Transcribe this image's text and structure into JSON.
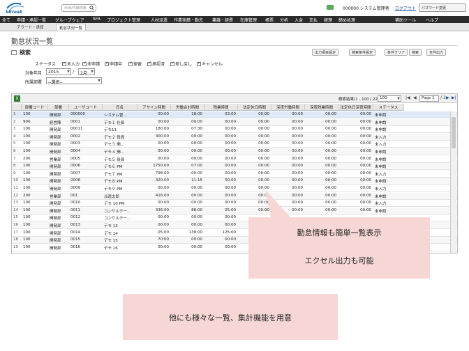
{
  "header": {
    "logo_text": "bBreak",
    "search_placeholder": "外線/内線検索",
    "user": "000000 システム管理者",
    "logout": "ログアウト",
    "password_button": "パスワード変更"
  },
  "menu": {
    "items": [
      "全て",
      "申請・承認一覧",
      "グループウェア",
      "SFA",
      "プロジェクト管理",
      "人材派遣",
      "作業実績・勤怠",
      "稟議・経費",
      "在庫管理",
      "帳票",
      "分析",
      "入金",
      "支払",
      "経理",
      "締め処理"
    ],
    "right": [
      "補助ツール",
      "ヘルプ"
    ]
  },
  "tabs": [
    "アラート・承認",
    "勤怠状況一覧"
  ],
  "page": {
    "title": "勤怠状況一覧"
  },
  "search": {
    "header": "検索",
    "buttons": [
      "出力項目設定",
      "検索条件設定",
      "条件クリア",
      "検索",
      "全件出力"
    ],
    "status_label": "ステータス",
    "statuses": [
      "未入力",
      "未申請",
      "申請中",
      "保留",
      "承認済",
      "差し戻し",
      "キャンセル"
    ],
    "month_label": "対象年月",
    "year": "2015",
    "month": "2月",
    "dept_label": "所属部署",
    "dept_value": "--選択--"
  },
  "grid": {
    "result_text": "検索結果(1 - 100 / 222)",
    "per_page": "100",
    "page": "Page 1",
    "page_total": "/ 3",
    "columns": [
      "部署コード",
      "部署",
      "ユーザコード",
      "氏名",
      "アサイン時間",
      "労働合計時間",
      "残業時間",
      "法定休日時間",
      "深夜労働時間",
      "深夜残業時間",
      "法定休日深夜時間",
      "ステータス"
    ],
    "rows": [
      [
        "1",
        "100",
        "開発部",
        "000000",
        "システム管…",
        "00:00",
        "18:00",
        "03:00",
        "00:00",
        "00:00",
        "00:00",
        "00:00",
        "未申請"
      ],
      [
        "2",
        "900",
        "経営陣",
        "0001",
        "デモ１ 社長",
        "00:00",
        "00:00",
        "00:00",
        "00:00",
        "00:00",
        "00:00",
        "00:00",
        "未申請"
      ],
      [
        "3",
        "100",
        "開発部",
        "00011",
        "デモ11",
        "180.00",
        "07:30",
        "00:00",
        "00:00",
        "00:00",
        "00:00",
        "00:00",
        "未申請"
      ],
      [
        "4",
        "100",
        "開発部",
        "0002",
        "デモ２ 役員",
        "300.00",
        "00:00",
        "00:00",
        "00:00",
        "00:00",
        "00:00",
        "00:00",
        "未入力"
      ],
      [
        "5",
        "100",
        "開発部",
        "0003",
        "デモ３ 開…",
        "00:00",
        "00:00",
        "00:00",
        "00:00",
        "00:00",
        "00:00",
        "00:00",
        "未入力"
      ],
      [
        "6",
        "100",
        "開発部",
        "0004",
        "デモ４ 開…",
        "00:00",
        "00:00",
        "00:00",
        "00:00",
        "00:00",
        "00:00",
        "00:00",
        "未申請"
      ],
      [
        "7",
        "200",
        "営業部",
        "0005",
        "デモ５ 役員",
        "00:00",
        "00:00",
        "00:00",
        "00:00",
        "00:00",
        "00:00",
        "00:00",
        "未申請"
      ],
      [
        "8",
        "100",
        "開発部",
        "0006",
        "デモ６ PM",
        "1750.00",
        "07:00",
        "00:00",
        "00:00",
        "00:00",
        "00:00",
        "00:00",
        "未申請"
      ],
      [
        "9",
        "100",
        "開発部",
        "0007",
        "デモ７ PM",
        "798.00",
        "00:00",
        "00:00",
        "00:00",
        "00:00",
        "00:00",
        "00:00",
        "未入力"
      ],
      [
        "10",
        "100",
        "開発部",
        "0008",
        "デモ８ PM",
        "320.00",
        "11:15",
        "00:00",
        "00:00",
        "00:00",
        "00:00",
        "00:00",
        "未申請"
      ],
      [
        "11",
        "100",
        "開発部",
        "0009",
        "デモ９ PM",
        "00:00",
        "00:00",
        "00:00",
        "00:00",
        "00:00",
        "00:00",
        "00:00",
        "未入力"
      ],
      [
        "12",
        "200",
        "営業部",
        "001",
        "派遣太郎",
        "416.00",
        "00:00",
        "00:00",
        "00:00",
        "00:00",
        "00:00",
        "00:00",
        "未申請"
      ],
      [
        "13",
        "100",
        "開発部",
        "0010",
        "デモ 10 PM",
        "00:00",
        "00:00",
        "00:00",
        "00:00",
        "00:00",
        "00:00",
        "00:00",
        "未入力"
      ],
      [
        "14",
        "100",
        "開発部",
        "0011",
        "コンサルテー…",
        "336.00",
        "88:00",
        "05:00",
        "00:00",
        "00:00",
        "00:00",
        "00:00",
        "未申請"
      ],
      [
        "15",
        "100",
        "開発部",
        "0012",
        "コンサルテー…",
        "00:00",
        "00:00",
        "00:00",
        "",
        "",
        "",
        "",
        ""
      ],
      [
        "16",
        "100",
        "開発部",
        "0013",
        "デモ 13",
        "00:00",
        "00:00",
        "00:00",
        "",
        "",
        "",
        "",
        ""
      ],
      [
        "17",
        "100",
        "開発部",
        "0014",
        "デモ 14",
        "05:00",
        "138:00",
        "125:00",
        "",
        "",
        "",
        "",
        ""
      ],
      [
        "18",
        "100",
        "開発部",
        "0015",
        "デモ 15",
        "70:00",
        "00:00",
        "00:00",
        "",
        "",
        "",
        "",
        ""
      ],
      [
        "19",
        "100",
        "開発部",
        "0016",
        "デモ 16",
        "00:00",
        "00:00",
        "00:00",
        "",
        "",
        "",
        "",
        ""
      ]
    ]
  },
  "callouts": {
    "box1_line1": "勤怠情報も簡単一覧表示",
    "box1_line2": "エクセル出力も可能",
    "box2": "他にも様々な一覧、集計機能を用意"
  },
  "colors": {
    "menu_bg": "#2b2b2b",
    "callout_bg": "#f6d7d5",
    "selected_row": "#dfe9f8"
  }
}
